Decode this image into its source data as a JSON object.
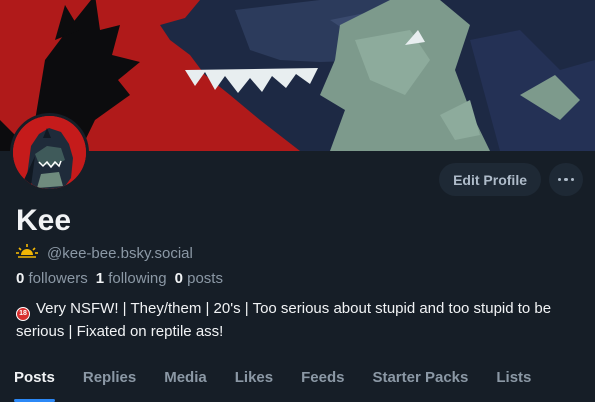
{
  "profile": {
    "display_name": "Kee",
    "handle": "@kee-bee.bsky.social",
    "handle_icon": "sunset-icon",
    "stats": {
      "followers_count": "0",
      "followers_label": "followers",
      "following_count": "1",
      "following_label": "following",
      "posts_count": "0",
      "posts_label": "posts"
    },
    "bio_icon": "no-under-18-icon",
    "bio": "Very NSFW! | They/them | 20's | Too serious about stupid and too stupid to be serious | Fixated on reptile ass!"
  },
  "actions": {
    "edit_profile_label": "Edit Profile",
    "more_icon": "more-horizontal-icon"
  },
  "tabs": [
    {
      "label": "Posts",
      "active": true
    },
    {
      "label": "Replies",
      "active": false
    },
    {
      "label": "Media",
      "active": false
    },
    {
      "label": "Likes",
      "active": false
    },
    {
      "label": "Feeds",
      "active": false
    },
    {
      "label": "Starter Packs",
      "active": false
    },
    {
      "label": "Lists",
      "active": false
    }
  ],
  "colors": {
    "background": "#161e27",
    "banner_red": "#b01a1a",
    "accent_blue": "#2b88f6",
    "muted_text": "#8b98a5"
  }
}
